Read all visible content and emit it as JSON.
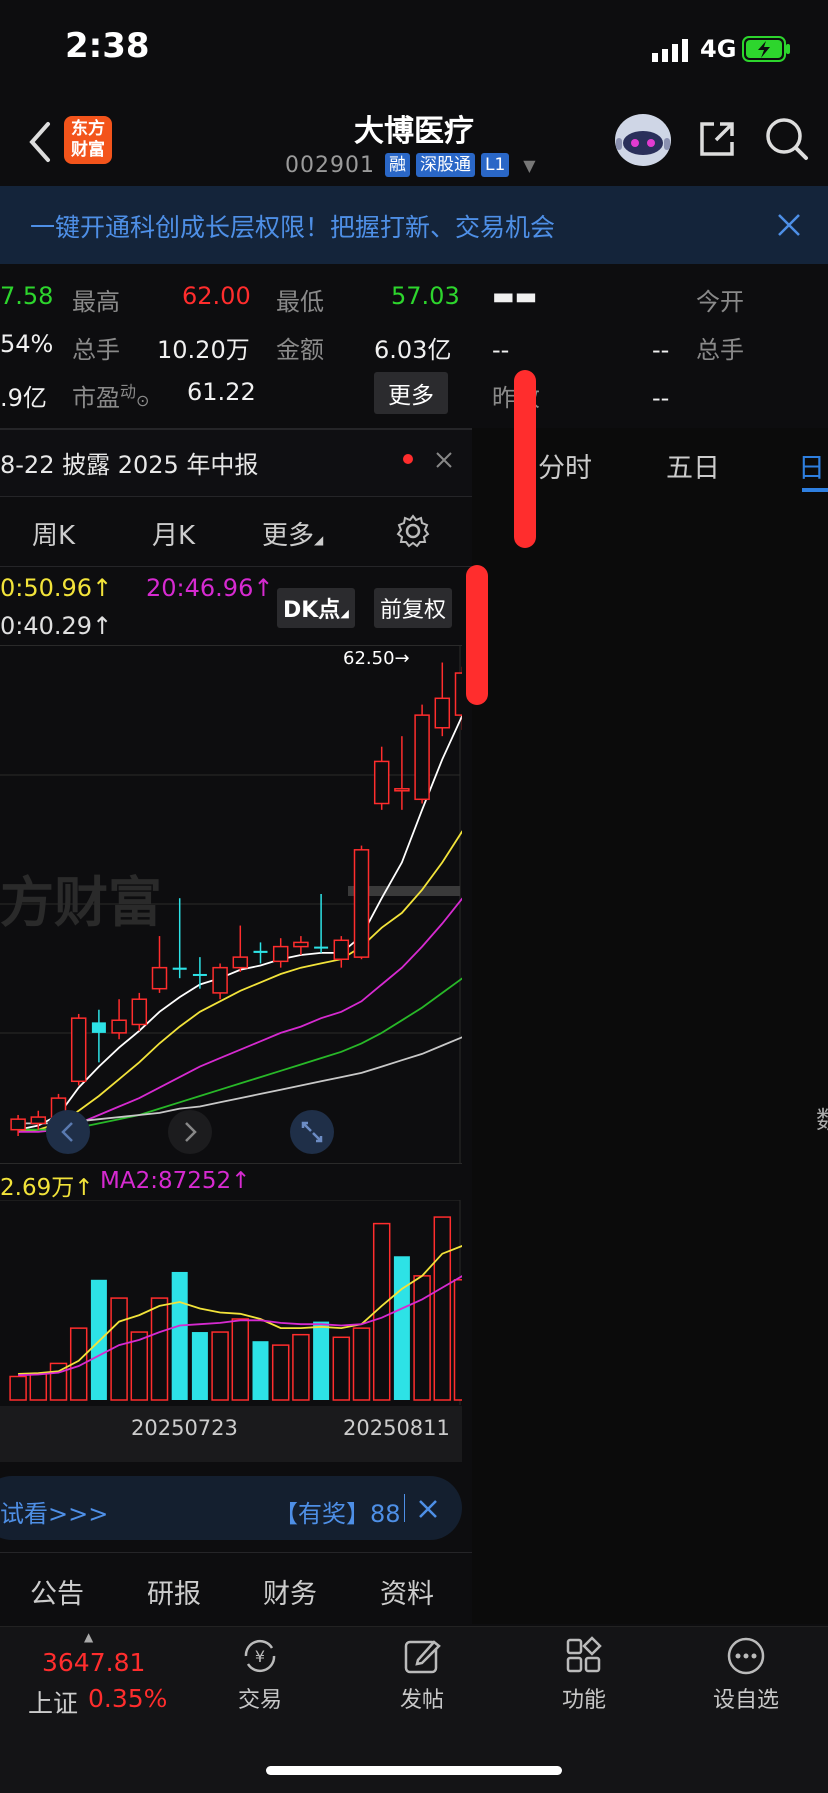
{
  "status": {
    "time": "2:38",
    "network": "4G"
  },
  "header": {
    "back_label": "back",
    "logo_text_line1": "东方",
    "logo_text_line2": "财富",
    "title": "大博医疗",
    "code": "002901",
    "tags": [
      "融",
      "深股通",
      "L1"
    ]
  },
  "banner": {
    "text": "一键开通科创成长层权限！把握打新、交易机会"
  },
  "quote": {
    "partial_price": "7.58",
    "high_label": "最高",
    "high_value": "62.00",
    "low_label": "最低",
    "low_value": "57.03",
    "partial_pct": "54%",
    "volume_label": "总手",
    "volume_value": "10.20万",
    "amount_label": "金额",
    "amount_value": "6.03亿",
    "partial_cap": ".9亿",
    "pe_label": "市盈",
    "pe_sup": "动",
    "pe_value": "61.22",
    "more_button": "更多",
    "right_dash_big": "▬▬",
    "right_dash1": "--",
    "right_dash2": "--",
    "right_dash3": "--",
    "right_dash4": "--",
    "today_open_label": "今开",
    "right_volume_label": "总手",
    "prev_close_label": "昨收"
  },
  "notice": {
    "text": "8-22 披露 2025 年中报"
  },
  "period_tabs": [
    "周K",
    "月K",
    "更多"
  ],
  "right_tabs": [
    "分时",
    "五日",
    "日"
  ],
  "ma_labels": {
    "ma_a": "0:50.96↑",
    "ma_b": "20:46.96↑",
    "ma_c": "0:40.29↑"
  },
  "chart_buttons": {
    "dk": "DK点",
    "adjust": "前复权"
  },
  "watermark": "方财富",
  "price_marker": "62.50→",
  "vol_labels": {
    "ma1": "2.69万↑",
    "ma2": "MA2:87252↑"
  },
  "chart_data": {
    "type": "candlestick",
    "x_tick_labels": [
      "20250723",
      "20250811"
    ],
    "candles": [
      {
        "o": 40.3,
        "c": 40.8,
        "h": 41.0,
        "l": 40.0,
        "up": true
      },
      {
        "o": 40.6,
        "c": 40.9,
        "h": 41.2,
        "l": 40.3,
        "up": true
      },
      {
        "o": 40.8,
        "c": 41.8,
        "h": 42.0,
        "l": 40.6,
        "up": true
      },
      {
        "o": 42.6,
        "c": 45.6,
        "h": 45.8,
        "l": 42.4,
        "up": true
      },
      {
        "o": 45.4,
        "c": 44.9,
        "h": 46.0,
        "l": 43.5,
        "up": false
      },
      {
        "o": 44.9,
        "c": 45.5,
        "h": 46.5,
        "l": 44.6,
        "up": true
      },
      {
        "o": 45.3,
        "c": 46.5,
        "h": 46.8,
        "l": 45.0,
        "up": true
      },
      {
        "o": 47.0,
        "c": 48.0,
        "h": 49.5,
        "l": 46.8,
        "up": true
      },
      {
        "o": 48.0,
        "c": 47.9,
        "h": 51.3,
        "l": 47.5,
        "up": false
      },
      {
        "o": 47.7,
        "c": 47.7,
        "h": 48.5,
        "l": 47.0,
        "up": false
      },
      {
        "o": 46.8,
        "c": 48.0,
        "h": 48.2,
        "l": 46.5,
        "up": true
      },
      {
        "o": 48.0,
        "c": 48.5,
        "h": 50.0,
        "l": 47.8,
        "up": true
      },
      {
        "o": 48.8,
        "c": 48.7,
        "h": 49.2,
        "l": 48.2,
        "up": false
      },
      {
        "o": 48.3,
        "c": 49.0,
        "h": 49.4,
        "l": 48.0,
        "up": true
      },
      {
        "o": 49.0,
        "c": 49.2,
        "h": 49.5,
        "l": 48.6,
        "up": true
      },
      {
        "o": 49.0,
        "c": 49.0,
        "h": 51.5,
        "l": 48.7,
        "up": false
      },
      {
        "o": 49.3,
        "c": 48.4,
        "h": 49.5,
        "l": 48.0,
        "up": true
      },
      {
        "o": 48.5,
        "c": 53.6,
        "h": 53.8,
        "l": 48.4,
        "up": true
      },
      {
        "o": 55.8,
        "c": 57.8,
        "h": 58.5,
        "l": 55.5,
        "up": true
      },
      {
        "o": 56.5,
        "c": 56.5,
        "h": 59.0,
        "l": 55.5,
        "up": true
      },
      {
        "o": 56.0,
        "c": 60.0,
        "h": 60.5,
        "l": 55.8,
        "up": true
      },
      {
        "o": 59.4,
        "c": 60.8,
        "h": 62.5,
        "l": 59.0,
        "up": true
      },
      {
        "o": 60.0,
        "c": 62.0,
        "h": 62.3,
        "l": 59.3,
        "up": true
      }
    ],
    "ma_lines": [
      {
        "color": "#ffffff",
        "values": [
          40.3,
          40.5,
          41.0,
          42.3,
          43.3,
          44.2,
          45.0,
          45.9,
          46.6,
          47.2,
          47.5,
          47.9,
          48.1,
          48.4,
          48.6,
          48.7,
          48.7,
          49.5,
          51.3,
          53.0,
          55.5,
          57.9,
          60.0
        ]
      },
      {
        "color": "#f2e33a",
        "values": [
          40.2,
          40.3,
          40.6,
          41.2,
          41.9,
          42.7,
          43.5,
          44.4,
          45.2,
          45.9,
          46.4,
          46.9,
          47.3,
          47.7,
          48.0,
          48.2,
          48.4,
          49.0,
          49.9,
          50.6,
          51.7,
          53.0,
          54.5
        ]
      },
      {
        "color": "#d62ad0",
        "values": [
          40.2,
          40.2,
          40.3,
          40.6,
          41.0,
          41.4,
          41.8,
          42.3,
          42.8,
          43.3,
          43.7,
          44.1,
          44.5,
          44.9,
          45.2,
          45.6,
          45.9,
          46.4,
          47.2,
          48.0,
          49.0,
          50.1,
          51.3
        ]
      },
      {
        "color": "#28b828",
        "values": [
          40.3,
          40.3,
          40.3,
          40.4,
          40.6,
          40.8,
          41.0,
          41.3,
          41.6,
          41.9,
          42.2,
          42.5,
          42.8,
          43.1,
          43.4,
          43.7,
          44.0,
          44.4,
          44.9,
          45.5,
          46.1,
          46.8,
          47.5
        ]
      },
      {
        "color": "#c8c8c8",
        "values": [
          40.6,
          40.6,
          40.6,
          40.7,
          40.8,
          40.9,
          41.0,
          41.1,
          41.3,
          41.4,
          41.6,
          41.8,
          42.0,
          42.2,
          42.4,
          42.6,
          42.8,
          43.0,
          43.3,
          43.6,
          43.9,
          44.3,
          44.7
        ]
      }
    ],
    "price_range": [
      40.0,
      63.0
    ],
    "volume": [
      {
        "v": 18000,
        "up": true
      },
      {
        "v": 20000,
        "up": true
      },
      {
        "v": 28000,
        "up": true
      },
      {
        "v": 55000,
        "up": true
      },
      {
        "v": 92000,
        "up": false
      },
      {
        "v": 78000,
        "up": true
      },
      {
        "v": 52000,
        "up": true
      },
      {
        "v": 78000,
        "up": true
      },
      {
        "v": 98000,
        "up": false
      },
      {
        "v": 52000,
        "up": false
      },
      {
        "v": 52000,
        "up": true
      },
      {
        "v": 62000,
        "up": true
      },
      {
        "v": 45000,
        "up": false
      },
      {
        "v": 42000,
        "up": true
      },
      {
        "v": 50000,
        "up": true
      },
      {
        "v": 60000,
        "up": false
      },
      {
        "v": 48000,
        "up": true
      },
      {
        "v": 55000,
        "up": true
      },
      {
        "v": 135000,
        "up": true
      },
      {
        "v": 110000,
        "up": false
      },
      {
        "v": 95000,
        "up": true
      },
      {
        "v": 140000,
        "up": true
      },
      {
        "v": 92000,
        "up": true
      }
    ],
    "volume_ma": [
      {
        "color": "#f2e33a",
        "values": [
          20000,
          20500,
          22000,
          30000,
          45000,
          60000,
          65000,
          72000,
          75000,
          70000,
          67000,
          66000,
          62000,
          55000,
          55000,
          56000,
          55000,
          58000,
          72000,
          85000,
          95000,
          112000,
          118000
        ]
      },
      {
        "color": "#d62ad0",
        "values": [
          19000,
          19500,
          21000,
          26000,
          34000,
          42000,
          46000,
          52000,
          57000,
          58000,
          59000,
          61000,
          61000,
          59000,
          58000,
          58000,
          57000,
          58000,
          63000,
          70000,
          77000,
          86000,
          95000
        ]
      }
    ],
    "volume_max": 150000
  },
  "promo": {
    "left_text": "试看>>>",
    "right_text": "【有奖】88"
  },
  "info_tabs": [
    "公告",
    "研报",
    "财务",
    "资料"
  ],
  "bottom_nav": {
    "index_value": "3647.81",
    "index_name": "上证",
    "index_change": "0.35%",
    "items": [
      "交易",
      "发帖",
      "功能",
      "设自选"
    ]
  },
  "right_edge_char": "数",
  "colors": {
    "up": "#ff2d2d",
    "down": "#2de2e6",
    "accent": "#2e7fe0"
  }
}
